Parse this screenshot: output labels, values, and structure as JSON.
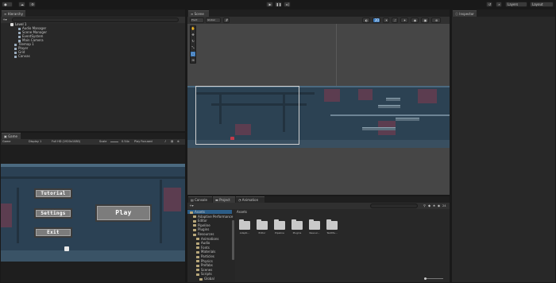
{
  "toolbar": {
    "account_label": "",
    "play_icon": "play-icon",
    "pause_icon": "pause-icon",
    "step_icon": "step-icon",
    "layers_label": "Layers",
    "layout_label": "Layout"
  },
  "hierarchy": {
    "tab_label": "Hierarchy",
    "scene_name": "Level 1",
    "items": [
      "Audio Manager",
      "Scene Manager",
      "EventSystem",
      "Main Camera",
      "Tilemap 1",
      "Player",
      "Grid",
      "Canvas"
    ]
  },
  "scene": {
    "tab_label": "Scene",
    "tool_global": "Pivot",
    "tool_local": "Global",
    "mode_2d": "2D"
  },
  "inspector": {
    "tab_label": "Inspector"
  },
  "game": {
    "tab_label": "Game",
    "display_select": "Game",
    "display_label": "Display 1",
    "resolution_label": "Full HD (1920x1080)",
    "scale_label": "Scale",
    "scale_value": "0.54x",
    "play_focused": "Play Focused",
    "buttons": {
      "tutorial": "Tutorial",
      "settings": "Settings",
      "play": "Play",
      "exit": "Exit"
    }
  },
  "bottom_tabs": {
    "console": "Console",
    "project": "Project",
    "animation": "Animation"
  },
  "project": {
    "breadcrumb": "Assets",
    "tree": [
      {
        "label": "Assets",
        "depth": 0
      },
      {
        "label": "Adaptive Performance",
        "depth": 1
      },
      {
        "label": "Editor",
        "depth": 1
      },
      {
        "label": "Pipeline",
        "depth": 1
      },
      {
        "label": "Plugins",
        "depth": 1
      },
      {
        "label": "Resources",
        "depth": 1
      },
      {
        "label": "Animations",
        "depth": 2
      },
      {
        "label": "Audio",
        "depth": 2
      },
      {
        "label": "Fonts",
        "depth": 2
      },
      {
        "label": "Materials",
        "depth": 2
      },
      {
        "label": "Particles",
        "depth": 2
      },
      {
        "label": "Physics",
        "depth": 2
      },
      {
        "label": "Prefabs",
        "depth": 2
      },
      {
        "label": "Scenes",
        "depth": 2
      },
      {
        "label": "Scripts",
        "depth": 2
      },
      {
        "label": "Global",
        "depth": 3
      }
    ],
    "grid": [
      "Adapti...",
      "Editor",
      "Pipeline",
      "Plugins",
      "Resour...",
      "TextMe..."
    ],
    "count_badge": "24"
  },
  "colors": {
    "panel_bg": "#282828",
    "game_bg": "#2b4154",
    "accent_blue": "#3a79bb"
  }
}
